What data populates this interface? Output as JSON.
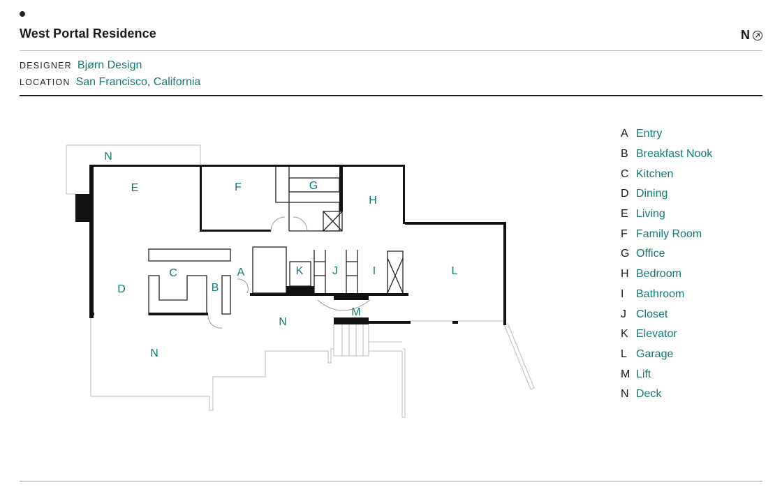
{
  "header": {
    "title": "West Portal Residence",
    "north_label": "N",
    "north_icon": "north-arrow-icon"
  },
  "meta": [
    {
      "key": "DESIGNER",
      "value": "Bjørn Design"
    },
    {
      "key": "LOCATION",
      "value": "San Francisco, California"
    }
  ],
  "colors": {
    "accent": "#127a74",
    "text": "#1a1a1a",
    "rule": "#c8c8c8"
  },
  "plan": {
    "labels": {
      "N1": "N",
      "E": "E",
      "F": "F",
      "G": "G",
      "H": "H",
      "C": "C",
      "A": "A",
      "K": "K",
      "J": "J",
      "I": "I",
      "L": "L",
      "D": "D",
      "B": "B",
      "M": "M",
      "N2": "N",
      "N3": "N"
    }
  },
  "legend": [
    {
      "key": "A",
      "label": "Entry"
    },
    {
      "key": "B",
      "label": "Breakfast Nook"
    },
    {
      "key": "C",
      "label": "Kitchen"
    },
    {
      "key": "D",
      "label": "Dining"
    },
    {
      "key": "E",
      "label": "Living"
    },
    {
      "key": "F",
      "label": "Family Room"
    },
    {
      "key": "G",
      "label": "Office"
    },
    {
      "key": "H",
      "label": "Bedroom"
    },
    {
      "key": "I",
      "label": "Bathroom"
    },
    {
      "key": "J",
      "label": "Closet"
    },
    {
      "key": "K",
      "label": "Elevator"
    },
    {
      "key": "L",
      "label": "Garage"
    },
    {
      "key": "M",
      "label": "Lift"
    },
    {
      "key": "N",
      "label": "Deck"
    }
  ]
}
